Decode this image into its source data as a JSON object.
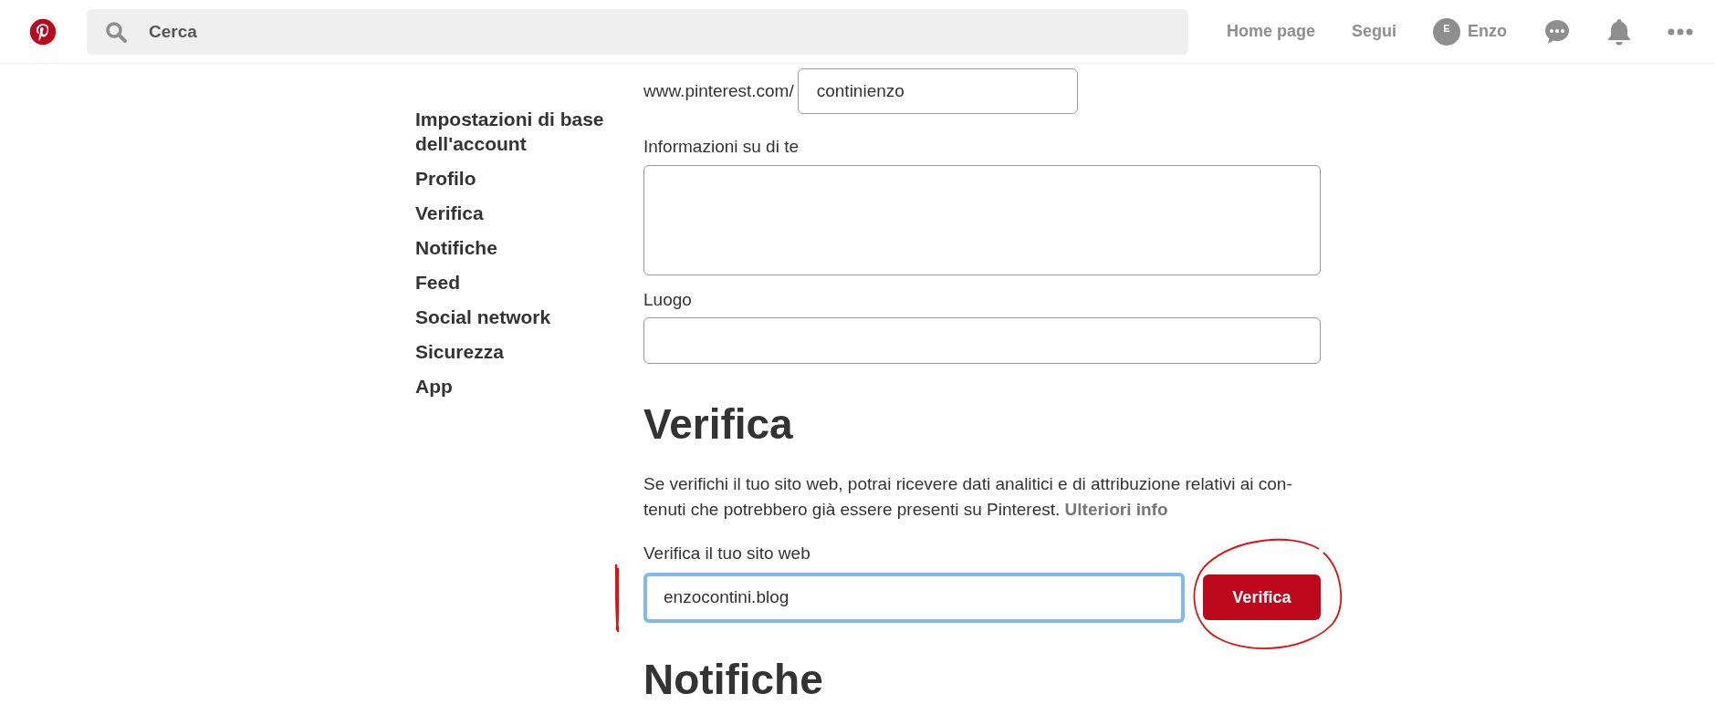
{
  "header": {
    "search": {
      "placeholder": "Cerca"
    },
    "nav": [
      {
        "kind": "link",
        "label": "Home page"
      },
      {
        "kind": "link",
        "label": "Segui"
      },
      {
        "kind": "user",
        "initial": "E",
        "label": "Enzo"
      },
      {
        "kind": "chat"
      },
      {
        "kind": "bell"
      },
      {
        "kind": "more"
      }
    ]
  },
  "sidebar": {
    "items": [
      "Impostazioni di base dell'account",
      "Profilo",
      "Verifica",
      "Notifiche",
      "Feed",
      "Social network",
      "Sicurezza",
      "App"
    ]
  },
  "profile": {
    "url_prefix": "www.pinterest.com/",
    "username": "continienzo",
    "about_label": "Informazioni su di te",
    "location_label": "Luogo"
  },
  "verify": {
    "heading": "Verifica",
    "description_lines": [
      "Se verifichi il tuo sito web, potrai ricevere dati analitici e di attribuzione relativi ai con-",
      "tenuti che potrebbero già essere presenti su Pinterest."
    ],
    "more_link": "Ulteriori info",
    "field_label": "Verifica il tuo sito web",
    "website": "enzocontini.blog",
    "focused": true,
    "button": "Verifica"
  },
  "next_heading": "Notifiche"
}
